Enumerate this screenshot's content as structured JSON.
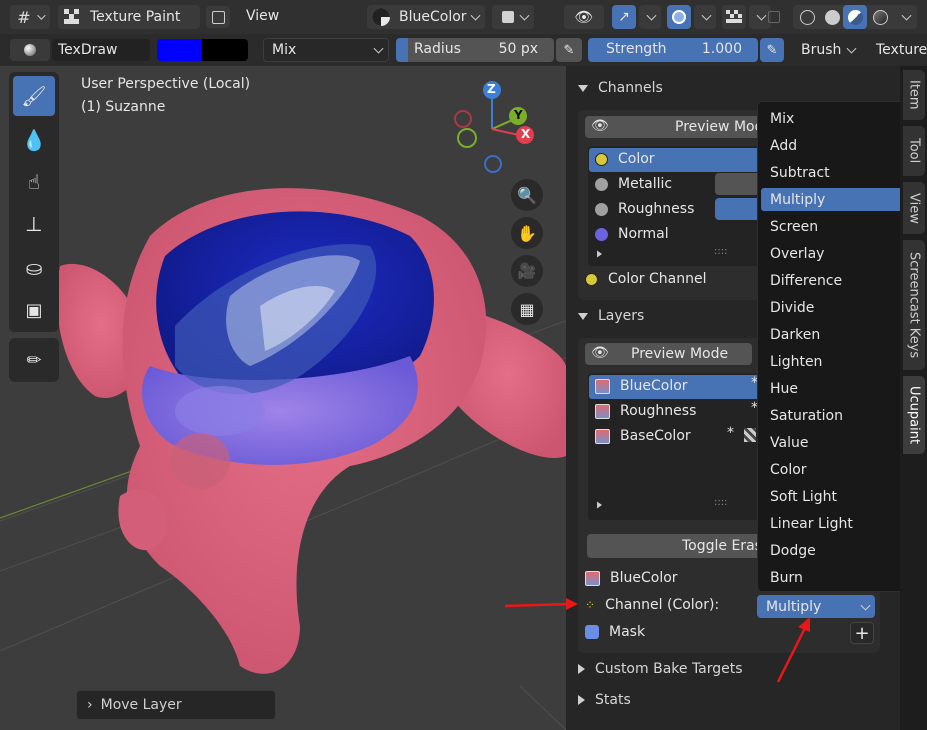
{
  "header": {
    "mode_label": "Texture Paint",
    "view_menu": "View",
    "image_label": "BlueColor"
  },
  "tool_settings": {
    "brush_name": "TexDraw",
    "blend_mode": "Mix",
    "radius_label": "Radius",
    "radius_value": "50 px",
    "strength_label": "Strength",
    "strength_value": "1.000",
    "brush_menu": "Brush",
    "texture_menu": "Texture",
    "primary_color": "#0000ff",
    "secondary_color": "#000000"
  },
  "viewport": {
    "perspective_label": "User Perspective (Local)",
    "object_label": "(1) Suzanne",
    "gizmo": {
      "z": "Z",
      "y": "Y",
      "x": "X"
    },
    "operator_panel": "Move Layer"
  },
  "panel": {
    "channels_header": "Channels",
    "channels_preview_mode": "Preview Mod",
    "channels": [
      {
        "label": "Color",
        "color": "#d7c838"
      },
      {
        "label": "Metallic",
        "color": "#a0a0a0"
      },
      {
        "label": "Roughness",
        "color": "#a0a0a0"
      },
      {
        "label": "Normal",
        "color": "#6b63e0"
      }
    ],
    "color_channel_label": "Color Channel",
    "layers_header": "Layers",
    "layers_preview_mode": "Preview Mode",
    "layers": [
      {
        "label": "BlueColor",
        "star": "*"
      },
      {
        "label": "Roughness",
        "star": "*"
      },
      {
        "label": "BaseColor",
        "star": "*"
      }
    ],
    "toggle_erase": "Toggle Eras",
    "active_layer": "BlueColor",
    "channel_color_label": "Channel (Color):",
    "channel_blend_value": "Multiply",
    "mask_label": "Mask",
    "custom_bake_targets": "Custom Bake Targets",
    "stats": "Stats"
  },
  "blend_menu": {
    "items": [
      "Mix",
      "Add",
      "Subtract",
      "Multiply",
      "Screen",
      "Overlay",
      "Difference",
      "Divide",
      "Darken",
      "Lighten",
      "Hue",
      "Saturation",
      "Value",
      "Color",
      "Soft Light",
      "Linear Light",
      "Dodge",
      "Burn"
    ],
    "selected": "Multiply"
  },
  "side_tabs": [
    "Item",
    "Tool",
    "View",
    "Screencast Keys",
    "Ucupaint"
  ]
}
